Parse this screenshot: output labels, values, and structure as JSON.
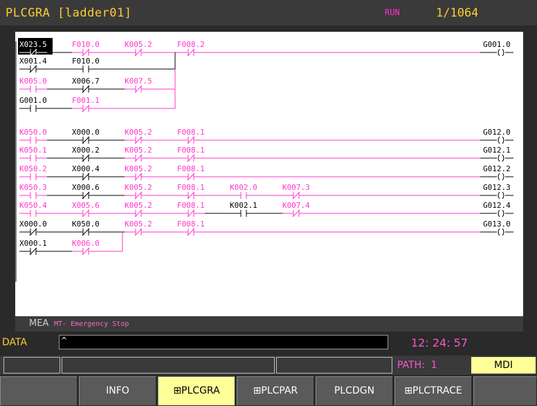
{
  "title": "PLCGRA [ladder01]",
  "status": "RUN",
  "step_count": "1/1064",
  "colors": {
    "active": "#ff33cc",
    "inactive": "#000000",
    "highlight_bg": "#000000",
    "title_text": "#ffcc33",
    "mode_bg": "#ffff99"
  },
  "ladder": {
    "rungs": [
      {
        "contacts": [
          {
            "addr": "X023.5",
            "type": "nc",
            "on": false,
            "sel": true
          },
          {
            "addr": "F010.0",
            "type": "nc",
            "on": true
          },
          {
            "addr": "K005.2",
            "type": "nc",
            "on": true
          },
          {
            "addr": "F008.2",
            "type": "nc",
            "on": true
          }
        ],
        "branches": [
          [
            {
              "addr": "X001.4",
              "type": "nc",
              "on": false
            },
            {
              "addr": "F010.0",
              "type": "no",
              "on": false
            }
          ],
          [
            {
              "addr": "K005.0",
              "type": "no",
              "on": true
            },
            {
              "addr": "X006.7",
              "type": "nc",
              "on": false
            },
            {
              "addr": "K007.5",
              "type": "nc",
              "on": true
            }
          ],
          [
            {
              "addr": "G001.0",
              "type": "no",
              "on": false
            },
            {
              "addr": "F001.1",
              "type": "nc",
              "on": true
            }
          ]
        ],
        "coil": "G001.0",
        "coil_on": false
      },
      {
        "contacts": [
          {
            "addr": "K050.0",
            "type": "no",
            "on": true
          },
          {
            "addr": "X000.0",
            "type": "nc",
            "on": false
          },
          {
            "addr": "K005.2",
            "type": "nc",
            "on": true
          },
          {
            "addr": "F008.1",
            "type": "nc",
            "on": true
          }
        ],
        "coil": "G012.0",
        "coil_on": false
      },
      {
        "contacts": [
          {
            "addr": "K050.1",
            "type": "no",
            "on": true
          },
          {
            "addr": "X000.2",
            "type": "nc",
            "on": false
          },
          {
            "addr": "K005.2",
            "type": "nc",
            "on": true
          },
          {
            "addr": "F008.1",
            "type": "nc",
            "on": true
          }
        ],
        "coil": "G012.1",
        "coil_on": false
      },
      {
        "contacts": [
          {
            "addr": "K050.2",
            "type": "no",
            "on": true
          },
          {
            "addr": "X000.4",
            "type": "nc",
            "on": false
          },
          {
            "addr": "K005.2",
            "type": "nc",
            "on": true
          },
          {
            "addr": "F008.1",
            "type": "nc",
            "on": true
          }
        ],
        "coil": "G012.2",
        "coil_on": false
      },
      {
        "contacts": [
          {
            "addr": "K050.3",
            "type": "no",
            "on": true
          },
          {
            "addr": "X000.6",
            "type": "nc",
            "on": false
          },
          {
            "addr": "K005.2",
            "type": "nc",
            "on": true
          },
          {
            "addr": "F008.1",
            "type": "nc",
            "on": true
          },
          {
            "addr": "K002.0",
            "type": "no",
            "on": true
          },
          {
            "addr": "K007.3",
            "type": "nc",
            "on": true
          }
        ],
        "coil": "G012.3",
        "coil_on": false
      },
      {
        "contacts": [
          {
            "addr": "K050.4",
            "type": "no",
            "on": true
          },
          {
            "addr": "X005.6",
            "type": "nc",
            "on": true
          },
          {
            "addr": "K005.2",
            "type": "nc",
            "on": true
          },
          {
            "addr": "F008.1",
            "type": "nc",
            "on": true
          },
          {
            "addr": "K002.1",
            "type": "no",
            "on": false
          },
          {
            "addr": "K007.4",
            "type": "nc",
            "on": true
          }
        ],
        "coil": "G012.4",
        "coil_on": false
      },
      {
        "contacts": [
          {
            "addr": "X000.0",
            "type": "nc",
            "on": false
          },
          {
            "addr": "K050.0",
            "type": "nc",
            "on": false
          },
          {
            "addr": "K005.2",
            "type": "nc",
            "on": true
          },
          {
            "addr": "F008.1",
            "type": "nc",
            "on": true
          }
        ],
        "branches": [
          [
            {
              "addr": "X000.1",
              "type": "nc",
              "on": false
            },
            {
              "addr": "K006.0",
              "type": "nc",
              "on": true
            }
          ]
        ],
        "coil": "G013.0",
        "coil_on": false
      }
    ]
  },
  "message": {
    "code": "MEA",
    "text": "MT- Emergency Stop"
  },
  "data_label": "DATA",
  "data_input": "^",
  "clock": "12: 24: 57",
  "path_label": "PATH:",
  "path_value": "1",
  "mode": "MDI",
  "softkeys": [
    {
      "label": "",
      "active": false
    },
    {
      "label": "INFO",
      "active": false
    },
    {
      "label": "⊞PLCGRA",
      "active": true
    },
    {
      "label": "⊞PLCPAR",
      "active": false
    },
    {
      "label": "PLCDGN",
      "active": false
    },
    {
      "label": "⊞PLCTRACE",
      "active": false
    },
    {
      "label": "",
      "active": false
    }
  ]
}
